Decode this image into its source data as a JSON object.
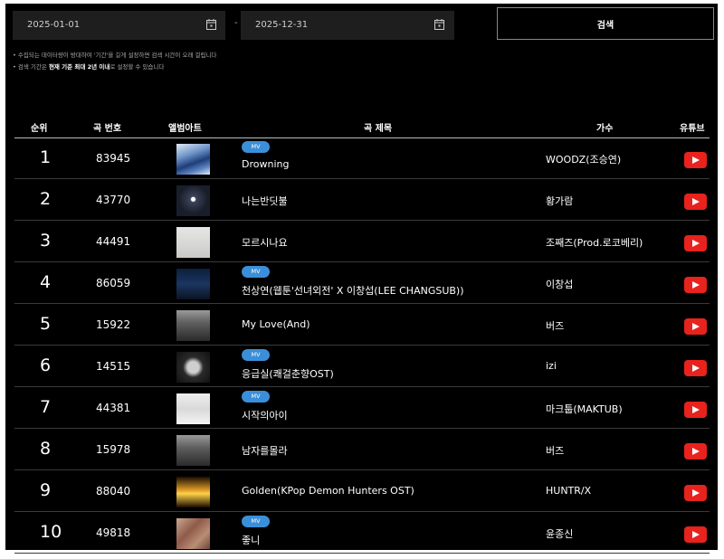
{
  "search": {
    "start_date": "2025-01-01",
    "end_date": "2025-12-31",
    "separator": "-",
    "button_label": "검색"
  },
  "notes": {
    "line1": "• 수집되는 데이터량이 방대하여 '기간'을 길게 설정하면 검색 시간이 오래 걸립니다",
    "line2_prefix": "• 검색 기간은 ",
    "line2_bold": "현재 기준 최대 2년 이내",
    "line2_suffix": "로 설정할 수 있습니다"
  },
  "table": {
    "headers": {
      "rank": "순위",
      "number": "곡 번호",
      "album": "앨범아트",
      "title": "곡 제목",
      "singer": "가수",
      "youtube": "유튜브"
    },
    "mv_label": "MV",
    "rows": [
      {
        "rank": "1",
        "number": "83945",
        "mv": true,
        "title": "Drowning",
        "singer": "WOODZ(조승연)"
      },
      {
        "rank": "2",
        "number": "43770",
        "mv": false,
        "title": "나는반딧불",
        "singer": "황가람"
      },
      {
        "rank": "3",
        "number": "44491",
        "mv": false,
        "title": "모르시나요",
        "singer": "조째즈(Prod.로코베리)"
      },
      {
        "rank": "4",
        "number": "86059",
        "mv": true,
        "title": "천상연(웹툰'선녀외전' X 이창섭(LEE CHANGSUB))",
        "singer": "이창섭"
      },
      {
        "rank": "5",
        "number": "15922",
        "mv": false,
        "title": "My Love(And)",
        "singer": "버즈"
      },
      {
        "rank": "6",
        "number": "14515",
        "mv": true,
        "title": "응급실(쾌걸춘향OST)",
        "singer": "izi"
      },
      {
        "rank": "7",
        "number": "44381",
        "mv": true,
        "title": "시작의아이",
        "singer": "마크툽(MAKTUB)"
      },
      {
        "rank": "8",
        "number": "15978",
        "mv": false,
        "title": "남자를몰라",
        "singer": "버즈"
      },
      {
        "rank": "9",
        "number": "88040",
        "mv": false,
        "title": "Golden(KPop Demon Hunters OST)",
        "singer": "HUNTR/X"
      },
      {
        "rank": "10",
        "number": "49818",
        "mv": true,
        "title": "좋니",
        "singer": "윤종신"
      }
    ]
  },
  "colors": {
    "background": "#000000",
    "input_bg": "#1e1e1e",
    "mv_badge": "#3b8fd8",
    "youtube_red": "#e8221c"
  },
  "icons": {
    "calendar": "calendar-icon",
    "youtube": "youtube-play-icon"
  }
}
